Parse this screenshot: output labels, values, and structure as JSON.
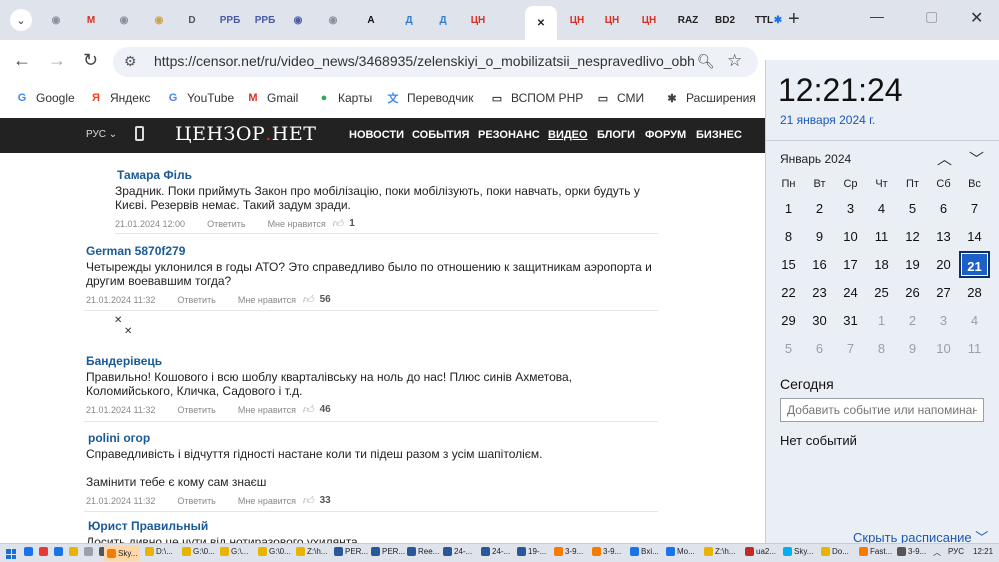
{
  "tabs": [
    {
      "favicon": "chrome-icon",
      "label": "",
      "color": "#8a8f99"
    },
    {
      "favicon": "gmail-icon",
      "label": "M",
      "color": "#d93025"
    },
    {
      "favicon": "site-icon",
      "label": "",
      "color": "#8a8f99"
    },
    {
      "favicon": "site-icon",
      "label": "",
      "color": "#caa34a"
    },
    {
      "favicon": "d-icon",
      "label": "D",
      "color": "#555"
    },
    {
      "favicon": "site-icon",
      "label": "РРБ",
      "color": "#4a5ca8"
    },
    {
      "favicon": "site-icon",
      "label": "РРБ",
      "color": "#4a5ca8"
    },
    {
      "favicon": "site-icon",
      "label": "",
      "color": "#4a5ca8"
    },
    {
      "favicon": "chrome-icon",
      "label": "",
      "color": "#8a8f99"
    },
    {
      "favicon": "a-icon",
      "label": "A",
      "color": "#111"
    },
    {
      "favicon": "d-icon",
      "label": "Д",
      "color": "#2f7fd0"
    },
    {
      "favicon": "d-icon",
      "label": "Д",
      "color": "#2f7fd0"
    },
    {
      "favicon": "censor-icon",
      "label": "ЦН",
      "color": "#d93025"
    },
    {
      "favicon": "close-icon",
      "label": "✕",
      "color": "#222"
    },
    {
      "favicon": "censor-icon",
      "label": "ЦН",
      "color": "#d93025"
    },
    {
      "favicon": "censor-icon",
      "label": "ЦН",
      "color": "#d93025"
    },
    {
      "favicon": "censor-icon",
      "label": "ЦН",
      "color": "#d93025"
    },
    {
      "favicon": "raz-icon",
      "label": "RAZ",
      "color": "#222"
    },
    {
      "favicon": "bd2-icon",
      "label": "BD2",
      "color": "#222"
    },
    {
      "favicon": "ttl-icon",
      "label": "TTL",
      "color": "#222"
    },
    {
      "favicon": "puzzle-icon",
      "label": "✱",
      "color": "#1a73e8"
    }
  ],
  "url": "https://censor.net/ru/video_news/3468935/zelenskiyi_o_mobilizatsii_nespravedlivo_obh...",
  "bookmarks": [
    {
      "label": "Google",
      "icon": "G",
      "color": "#4285f4"
    },
    {
      "label": "Яндекс",
      "icon": "Я",
      "color": "#fc3f1d"
    },
    {
      "label": "YouTube",
      "icon": "G",
      "color": "#4285f4"
    },
    {
      "label": "Gmail",
      "icon": "M",
      "color": "#d93025"
    },
    {
      "label": "Карты",
      "icon": "●",
      "color": "#34a853"
    },
    {
      "label": "Переводчик",
      "icon": "文",
      "color": "#4285f4"
    },
    {
      "label": "ВСПОМ РНР",
      "icon": "▭",
      "color": "#444"
    },
    {
      "label": "СМИ",
      "icon": "▭",
      "color": "#444"
    },
    {
      "label": "Расширения",
      "icon": "✱",
      "color": "#444"
    }
  ],
  "site": {
    "lang": "РУС",
    "logo_main": "ЦЕНЗОР",
    "logo_dot": ".",
    "logo_net": "НЕТ",
    "nav": [
      "НОВОСТИ",
      "СОБЫТИЯ",
      "РЕЗОНАНС",
      "ВИДЕО",
      "БЛОГИ",
      "ФОРУМ",
      "БИЗНЕС"
    ]
  },
  "comments": [
    {
      "author": "Тамара Філь",
      "text": "Зрадник. Поки приймуть Закон про мобілізацію, поки мобілізують, поки навчать, орки будуть у Києві. Резервів немає. Такий задум зради.",
      "date": "21.01.2024 12:00",
      "reply": "Ответить",
      "like_label": "Мне нравится",
      "likes": "1"
    },
    {
      "author": "German 5870f279",
      "text": "Четырежды уклонился в годы АТО? Это справедливо было по отношению к защитникам аэропорта и другим воевавшим тогда?",
      "date": "21.01.2024 11:32",
      "reply": "Ответить",
      "like_label": "Мне нравится",
      "likes": "56"
    },
    {
      "author": "Бандерівець",
      "text": "Правильно! Кошового і всю шоблу кварталівську на ноль до нас! Плюс синів Ахметова, Коломийського, Кличка, Садового і т.д.",
      "date": "21.01.2024 11:32",
      "reply": "Ответить",
      "like_label": "Мне нравится",
      "likes": "46"
    },
    {
      "author": "polini oгор",
      "text": "Справедливість і відчуття гідності настане коли ти підеш разом з усім шапітолієм.",
      "text2": "Замінити тебе є кому сам знаєш",
      "date": "21.01.2024 11:32",
      "reply": "Ответить",
      "like_label": "Мне нравится",
      "likes": "33"
    },
    {
      "author": "Юрист Правильный",
      "text": "Досить дивно це чути від нотиразового ухилянта"
    }
  ],
  "calendar": {
    "time": "12:21:24",
    "date_long": "21 января 2024 г.",
    "month": "Январь 2024",
    "weekdays": [
      "Пн",
      "Вт",
      "Ср",
      "Чт",
      "Пт",
      "Сб",
      "Вс"
    ],
    "weeks": [
      [
        "1",
        "2",
        "3",
        "4",
        "5",
        "6",
        "7"
      ],
      [
        "8",
        "9",
        "10",
        "11",
        "12",
        "13",
        "14"
      ],
      [
        "15",
        "16",
        "17",
        "18",
        "19",
        "20",
        "21"
      ],
      [
        "22",
        "23",
        "24",
        "25",
        "26",
        "27",
        "28"
      ],
      [
        "29",
        "30",
        "31",
        "1",
        "2",
        "3",
        "4"
      ],
      [
        "5",
        "6",
        "7",
        "8",
        "9",
        "10",
        "11"
      ]
    ],
    "today": "21",
    "today_title": "Сегодня",
    "event_placeholder": "Добавить событие или напоминан",
    "no_events": "Нет событий",
    "hide_schedule": "Скрыть расписание ﹀"
  },
  "taskbar": {
    "items": [
      {
        "label": "Sky...",
        "color": "#f57c00",
        "highlight": true
      },
      {
        "label": "D:\\...",
        "color": "#e8b400"
      },
      {
        "label": "G:\\0...",
        "color": "#e8b400"
      },
      {
        "label": "G:\\...",
        "color": "#e8b400"
      },
      {
        "label": "G:\\0...",
        "color": "#e8b400"
      },
      {
        "label": "Z:\\h...",
        "color": "#e8b400"
      },
      {
        "label": "PER...",
        "color": "#2b579a"
      },
      {
        "label": "PER...",
        "color": "#2b579a"
      },
      {
        "label": "Ree...",
        "color": "#2b579a"
      },
      {
        "label": "24-...",
        "color": "#2b579a"
      },
      {
        "label": "24-...",
        "color": "#2b579a"
      },
      {
        "label": "19-...",
        "color": "#2b579a"
      },
      {
        "label": "3-9...",
        "color": "#f57c00"
      },
      {
        "label": "3-9...",
        "color": "#f57c00"
      },
      {
        "label": "Bxi...",
        "color": "#1a73e8"
      },
      {
        "label": "Mo...",
        "color": "#1a73e8"
      },
      {
        "label": "Z:\\h...",
        "color": "#e8b400"
      },
      {
        "label": "ua2...",
        "color": "#c62828"
      },
      {
        "label": "Sky...",
        "color": "#00aff0"
      },
      {
        "label": "Do...",
        "color": "#e8b400"
      },
      {
        "label": "Fast...",
        "color": "#f57c00"
      },
      {
        "label": "3-9...",
        "color": "#555"
      }
    ],
    "lang": "РУС",
    "time": "12:21"
  }
}
